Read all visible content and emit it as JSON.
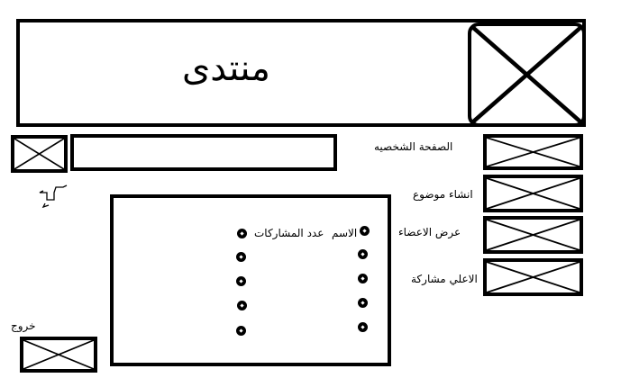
{
  "header": {
    "title": "منتدى",
    "logo_icon": "image-placeholder-icon"
  },
  "search": {
    "icon": "image-placeholder-icon",
    "placeholder": ""
  },
  "back": {
    "icon": "arrow-icon"
  },
  "sidebar": {
    "items": [
      {
        "label": "الصفحة الشخصيه",
        "icon": "image-placeholder-icon"
      },
      {
        "label": "انشاء موضوع",
        "icon": "image-placeholder-icon"
      },
      {
        "label": "عرض الاعضاء",
        "icon": "image-placeholder-icon"
      },
      {
        "label": "الاعلي مشاركة",
        "icon": "image-placeholder-icon"
      }
    ]
  },
  "members_table": {
    "columns": {
      "name": "الاسم",
      "posts": "عدد المشاركات"
    },
    "rows": [
      {
        "name": "",
        "posts": ""
      },
      {
        "name": "",
        "posts": ""
      },
      {
        "name": "",
        "posts": ""
      },
      {
        "name": "",
        "posts": ""
      },
      {
        "name": "",
        "posts": ""
      }
    ]
  },
  "logout": {
    "label": "خروج",
    "icon": "image-placeholder-icon"
  }
}
